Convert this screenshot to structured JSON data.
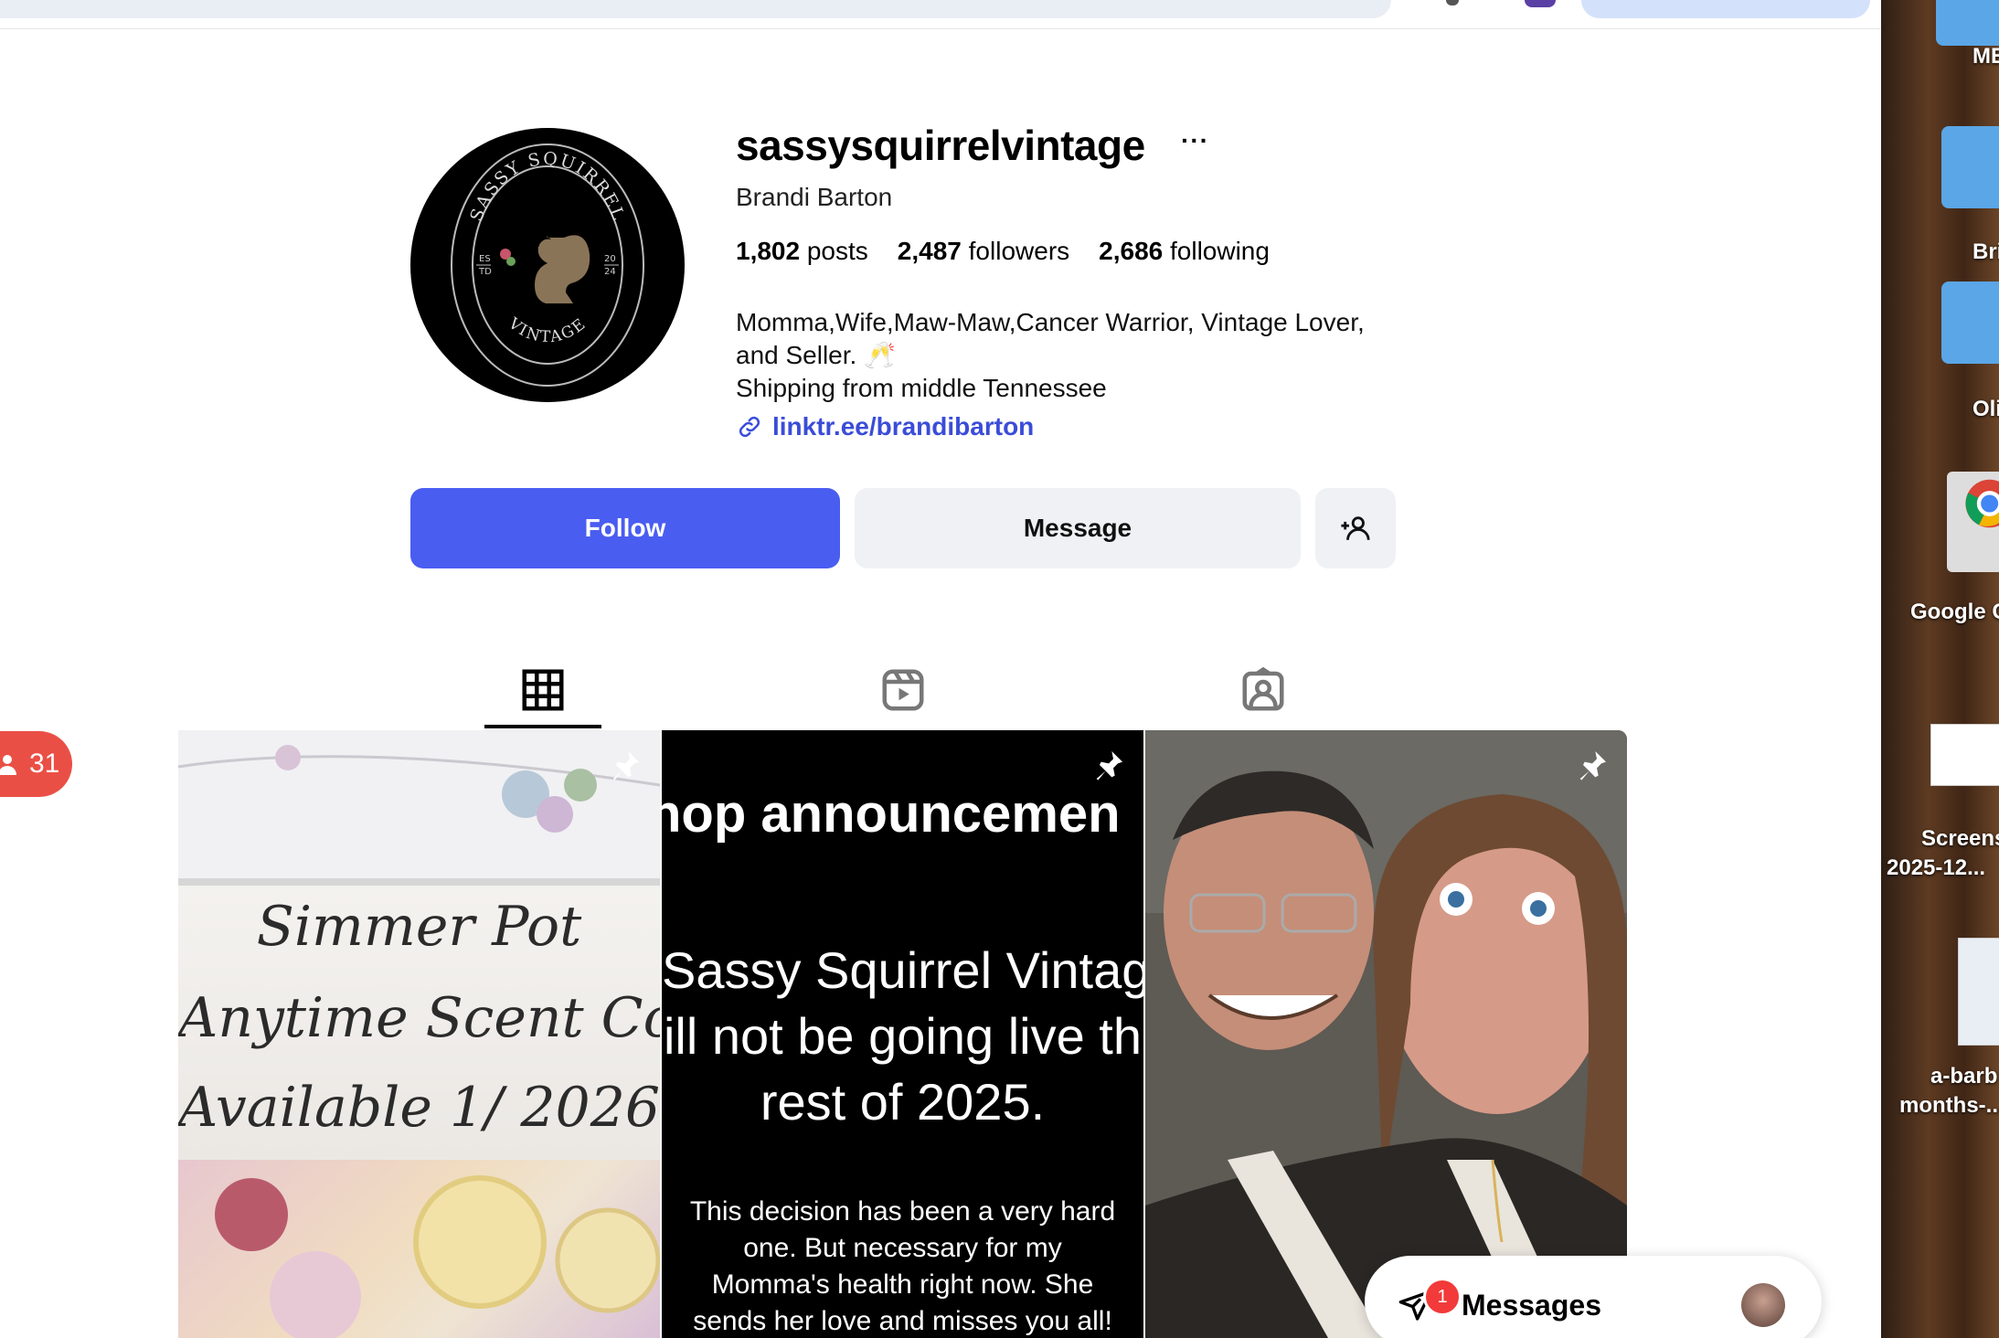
{
  "profile": {
    "username": "sassysquirrelvintage",
    "more_label": "···",
    "full_name": "Brandi Barton",
    "stats": {
      "posts": "1,802",
      "posts_label": "posts",
      "followers": "2,487",
      "followers_label": "followers",
      "following": "2,686",
      "following_label": "following"
    },
    "bio_line1": "Momma,Wife,Maw-Maw,Cancer Warrior, Vintage Lover,",
    "bio_line2": "and Seller. 🥂",
    "bio_line3": "Shipping from middle Tennessee",
    "link": "linktr.ee/brandibarton",
    "avatar_logo": {
      "top": "SASSY SQUIRREL",
      "bottom": "VINTAGE",
      "est_left": "ES TD",
      "est_right": "20 24"
    }
  },
  "actions": {
    "follow": "Follow",
    "message": "Message"
  },
  "tabs": [
    {
      "icon": "grid-icon",
      "active": true
    },
    {
      "icon": "reels-icon"
    },
    {
      "icon": "tagged-icon"
    }
  ],
  "posts": [
    {
      "lines": [
        "Simmer Pot",
        "Anytime Scent Collecti",
        "Available 1/ 2026"
      ],
      "pinned": true
    },
    {
      "heading": "hop announcemen",
      "body_lines": [
        "Sassy Squirrel Vintage",
        "ill not be going live th",
        "rest of 2025."
      ],
      "small_lines": [
        "This decision has been a very hard",
        "one. But necessary for my",
        "Momma's health right now. She",
        "sends her love and misses you all!"
      ],
      "pinned": true
    },
    {
      "pinned": true
    }
  ],
  "side_notification": {
    "count": "31"
  },
  "messages_bar": {
    "label": "Messages",
    "badge": "1"
  },
  "desktop": {
    "labels": [
      "ME",
      "Bri",
      "Oli",
      "Google C",
      "Screens",
      "2025-12...",
      "a-barb",
      "months-..."
    ]
  },
  "colors": {
    "follow": "#4a5df1",
    "link": "#3b4cd8",
    "badge": "#ea4f45"
  }
}
